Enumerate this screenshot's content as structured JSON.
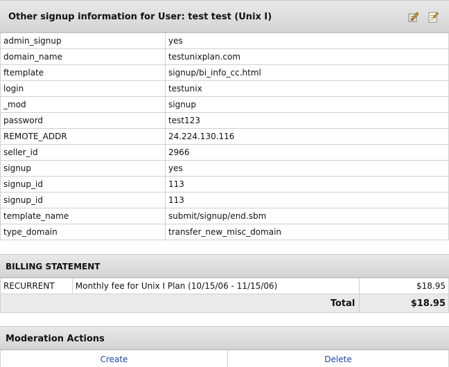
{
  "signup_panel": {
    "title": "Other signup information for User: test test (Unix I)",
    "icons": [
      "edit-icon",
      "note-icon"
    ],
    "rows": [
      {
        "key": "admin_signup",
        "value": "yes"
      },
      {
        "key": "domain_name",
        "value": "testunixplan.com"
      },
      {
        "key": "ftemplate",
        "value": "signup/bi_info_cc.html"
      },
      {
        "key": "login",
        "value": "testunix"
      },
      {
        "key": "_mod",
        "value": "signup"
      },
      {
        "key": "password",
        "value": "test123"
      },
      {
        "key": "REMOTE_ADDR",
        "value": "24.224.130.116"
      },
      {
        "key": "seller_id",
        "value": "2966"
      },
      {
        "key": "signup",
        "value": "yes"
      },
      {
        "key": "signup_id",
        "value": "113"
      },
      {
        "key": "signup_id",
        "value": "113"
      },
      {
        "key": "template_name",
        "value": "submit/signup/end.sbm"
      },
      {
        "key": "type_domain",
        "value": "transfer_new_misc_domain"
      }
    ]
  },
  "billing": {
    "title": "BILLING STATEMENT",
    "line": {
      "type": "RECURRENT",
      "description": "Monthly fee for Unix I Plan (10/15/06 - 11/15/06)",
      "amount": "$18.95"
    },
    "total_label": "Total",
    "total_amount": "$18.95"
  },
  "moderation": {
    "title": "Moderation Actions",
    "create_label": "Create",
    "delete_label": "Delete"
  },
  "colors": {
    "header_bg": "#d9d9d9",
    "link": "#1a46b0",
    "border": "#d0d0d0"
  }
}
